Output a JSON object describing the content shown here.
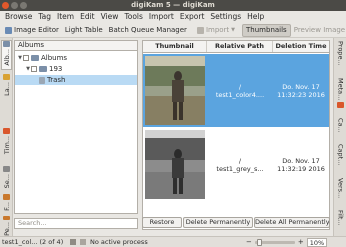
{
  "window": {
    "title": "digiKam 5 — digiKam"
  },
  "menu": [
    "Browse",
    "Tag",
    "Item",
    "Edit",
    "View",
    "Tools",
    "Import",
    "Export",
    "Settings",
    "Help"
  ],
  "toolbar": {
    "image_editor": "Image Editor",
    "light_table": "Light Table",
    "batch_queue": "Batch Queue Manager",
    "import": "Import",
    "thumbnails": "Thumbnails",
    "preview_image": "Preview Image"
  },
  "left_tabs": [
    "Alb...",
    "La...",
    "Tim...",
    "Se...",
    "F...",
    "Pe..."
  ],
  "album_panel": {
    "header": "Albums",
    "tree": [
      {
        "label": "Albums",
        "level": 0,
        "arrow": "▼"
      },
      {
        "label": "193",
        "level": 1,
        "arrow": "▼"
      },
      {
        "label": "Trash",
        "level": 2,
        "arrow": ""
      }
    ],
    "search_placeholder": "Search..."
  },
  "trash_view": {
    "columns": [
      "Thumbnail",
      "Relative Path",
      "Deletion Time"
    ],
    "rows": [
      {
        "path_top": "/",
        "path": "test1_color4....",
        "date": "Do. Nov. 17",
        "time": "11:32:23 2016",
        "selected": true,
        "photo": "color"
      },
      {
        "path_top": "/",
        "path": "test1_grey_s...",
        "date": "Do. Nov. 17",
        "time": "11:32:19 2016",
        "selected": false,
        "photo": "grey"
      }
    ],
    "buttons": [
      "Restore",
      "Delete Permanently",
      "Delete All Permanently"
    ]
  },
  "right_tabs": [
    "Prope...",
    "Meta...",
    "Ca...",
    "Capt...",
    "Vers...",
    "Filt..."
  ],
  "status": {
    "current_item": "test1_col... (2 of 4)",
    "process": "No active process",
    "zoom": "10%"
  },
  "colors": {
    "selection": "#5ba4df",
    "tree_selection": "#b9daf4",
    "titlebar": "#4b4a46",
    "close_button": "#e2582b"
  }
}
